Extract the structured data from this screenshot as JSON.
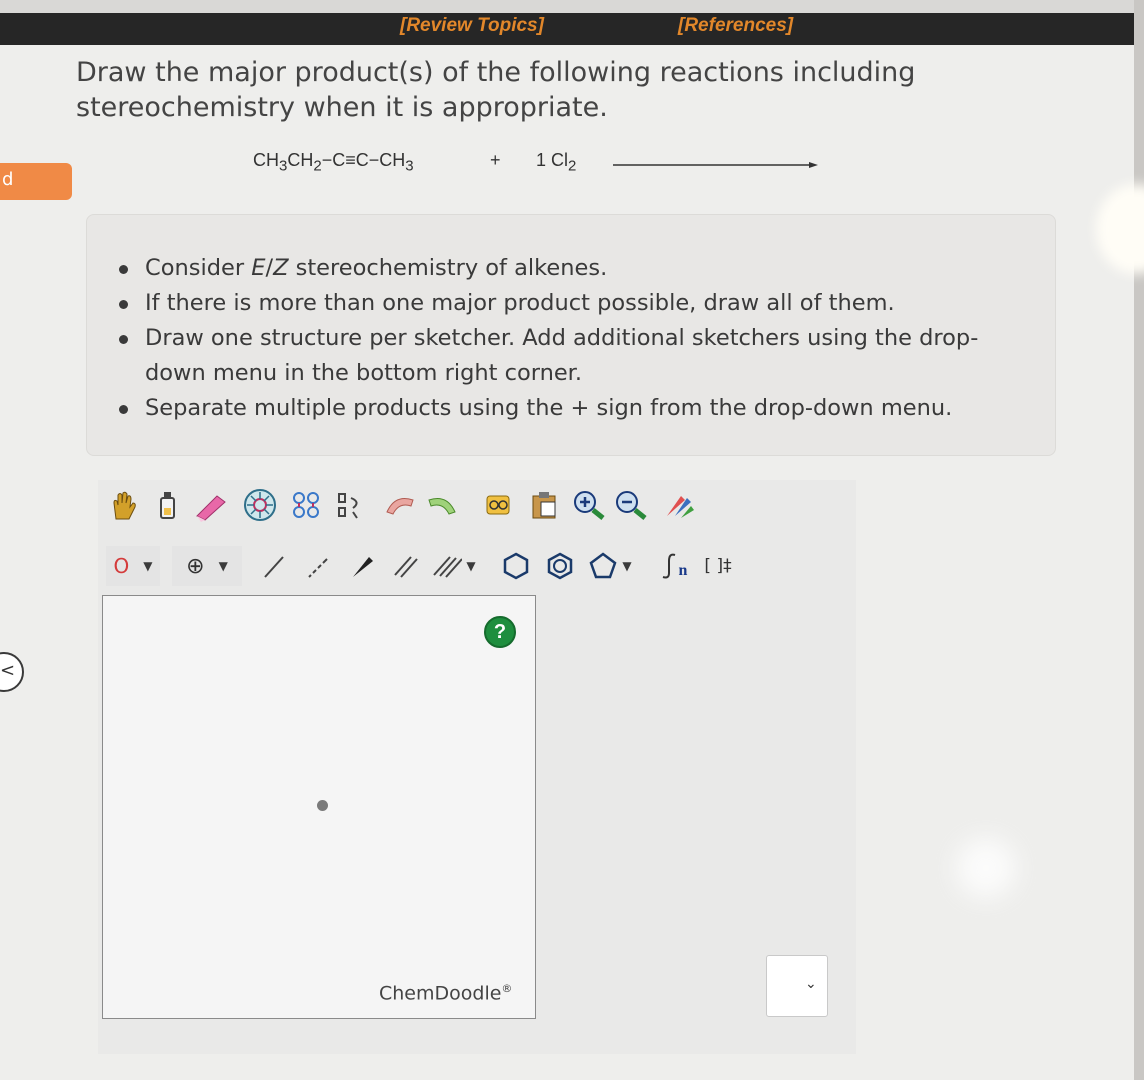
{
  "header": {
    "review_topics": "[Review Topics]",
    "references": "[References]"
  },
  "question": {
    "text": "Draw the major product(s) of the following reactions including stereochemistry when it is appropriate."
  },
  "reaction": {
    "reactant_html": "CH<sub>3</sub>CH<sub>2</sub>−C≡C−CH<sub>3</sub>",
    "plus": "+",
    "reagent_html": "1 Cl<sub>2</sub>"
  },
  "instructions": [
    {
      "html": "Consider <i>E</i>/<i>Z</i> stereochemistry of alkenes."
    },
    {
      "html": "If there is more than one major product possible, draw all of them."
    },
    {
      "html": "Draw one structure per sketcher. Add additional sketchers using the drop-down menu in the bottom right corner."
    },
    {
      "html": "Separate multiple products using the + sign from the drop-down menu."
    }
  ],
  "toolbar": {
    "top_tools": [
      "hand-icon",
      "lasso-icon",
      "eraser-icon",
      "ring-template-icon",
      "atom-map-icon",
      "clean-icon",
      "undo-icon",
      "redo-icon",
      "copy-icon",
      "paste-icon",
      "zoom-in-icon",
      "zoom-out-icon",
      "color-icon"
    ],
    "atom_label": "O",
    "charge_label": "⊕",
    "sgroup_label": "n",
    "bracket_label": "[ ]‡"
  },
  "sketcher": {
    "help": "?",
    "brand": "ChemDoodle",
    "brand_mark": "®"
  },
  "left_tab": {
    "label": "d"
  },
  "left_circle": {
    "label": "<"
  },
  "dropdown": {
    "chevron": "⌄"
  },
  "colors": {
    "accent_orange": "#e2872a",
    "topbar": "#262626",
    "help_green": "#1e8e3e",
    "tab_orange": "#f08a46"
  }
}
